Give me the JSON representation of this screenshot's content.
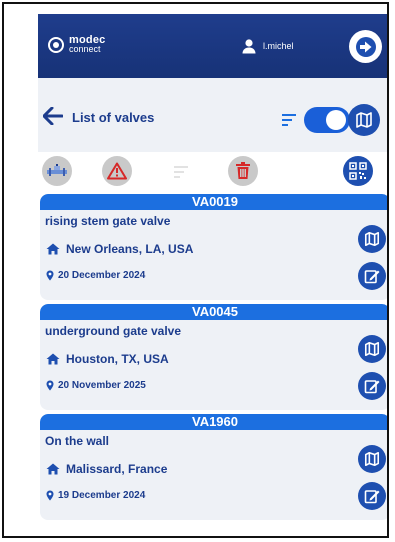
{
  "app": {
    "brand_line1": "modec",
    "brand_line2": "connect",
    "username": "l.michel"
  },
  "header": {
    "title": "List of valves"
  },
  "colors": {
    "topbar": "#1f3d8c",
    "accent": "#1c6fe0",
    "card_bg": "#eef1f6",
    "text": "#1c3c8d",
    "alert_red": "#d62828"
  },
  "toolbar": {
    "icons": [
      "pipeline-icon",
      "warning-icon",
      "sort-icon",
      "trash-icon",
      "qr-code-icon"
    ]
  },
  "valves": [
    {
      "id": "VA0019",
      "description": "rising stem gate valve",
      "location": "New Orleans, LA, USA",
      "date": "20 December 2024"
    },
    {
      "id": "VA0045",
      "description": "underground gate valve",
      "location": "Houston, TX, USA",
      "date": "20 November 2025"
    },
    {
      "id": "VA1960",
      "description": "On the wall",
      "location": "Malissard, France",
      "date": "19 December 2024"
    }
  ]
}
